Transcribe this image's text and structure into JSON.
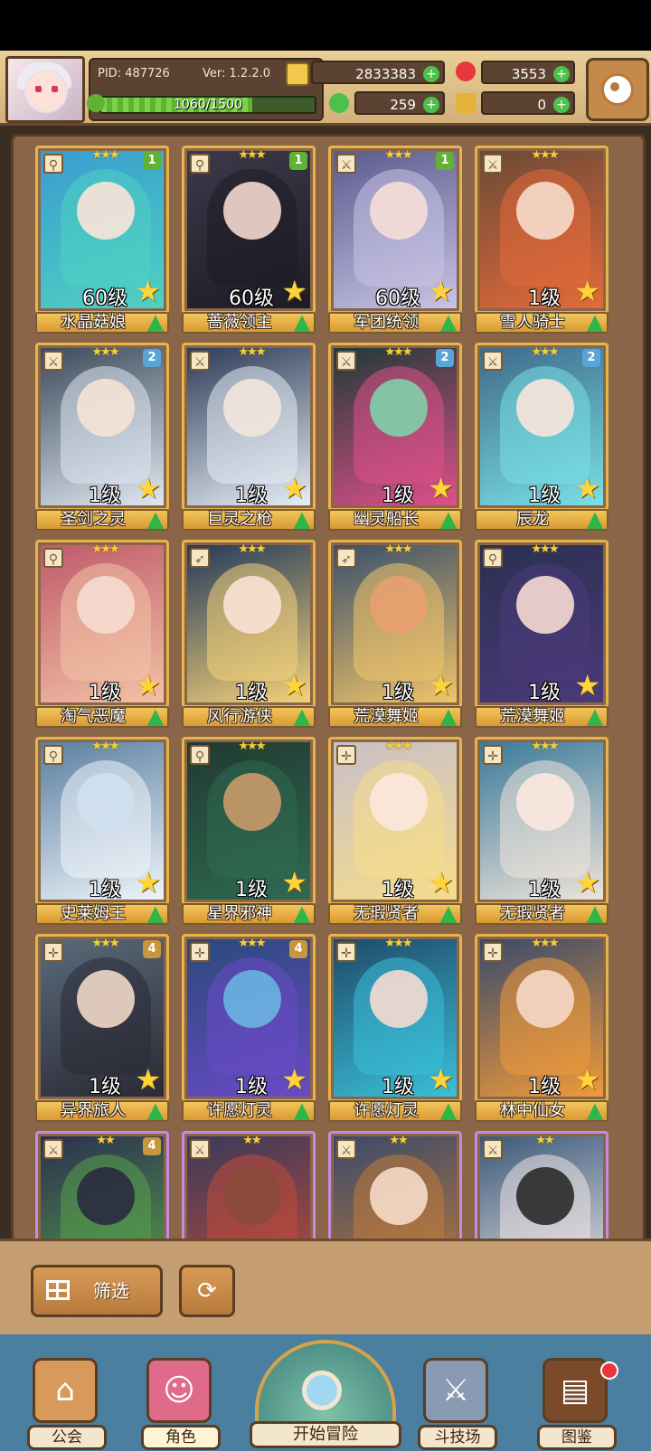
{
  "header": {
    "pid": "PID: 487726",
    "version": "Ver: 1.2.2.0",
    "xp": {
      "text": "1060/1500",
      "current": 1060,
      "max": 1500
    },
    "gold": "2833383",
    "gems": "3553",
    "clover": "259",
    "keys": "0"
  },
  "colors": {
    "gold_frame": "#e6b44a",
    "purple_frame": "#c58be2",
    "badge_green": "#5fb234",
    "badge_blue": "#5aa5d8",
    "badge_tan": "#c8963c",
    "upgrade_green": "#2fb548"
  },
  "cards": [
    {
      "name": "水晶菇娘",
      "level": "60级",
      "stars": "★★★",
      "badge": "1",
      "badge_color": "#5fb234",
      "class_icon": "staff-icon",
      "palette": [
        "#3a9ccf",
        "#4fd1c3",
        "#fbe4d8"
      ],
      "rarity": "gold"
    },
    {
      "name": "蔷薇领主",
      "level": "60级",
      "stars": "★★★",
      "badge": "1",
      "badge_color": "#5fb234",
      "class_icon": "staff-icon",
      "palette": [
        "#3b3a4a",
        "#1d1b24",
        "#f6d8d0"
      ],
      "rarity": "gold"
    },
    {
      "name": "军团统领",
      "level": "60级",
      "stars": "★★★",
      "badge": "1",
      "badge_color": "#5fb234",
      "class_icon": "sword-icon",
      "palette": [
        "#5a5a8c",
        "#c8c4e6",
        "#f6ded6"
      ],
      "rarity": "gold"
    },
    {
      "name": "雪人骑士",
      "level": "1级",
      "stars": "★★★",
      "badge": "",
      "badge_color": "",
      "class_icon": "sword-icon",
      "palette": [
        "#6b4a36",
        "#e46a3a",
        "#f7dccc"
      ],
      "rarity": "gold"
    },
    {
      "name": "圣剑之灵",
      "level": "1级",
      "stars": "★★★",
      "badge": "2",
      "badge_color": "#5aa5d8",
      "class_icon": "sword-icon",
      "palette": [
        "#3d4a5a",
        "#dfe8f2",
        "#f6e2d6"
      ],
      "rarity": "gold"
    },
    {
      "name": "巨灵之枪",
      "level": "1级",
      "stars": "★★★",
      "badge": "",
      "badge_color": "",
      "class_icon": "sword-icon",
      "palette": [
        "#2d3b56",
        "#e6eef6",
        "#f2e6dc"
      ],
      "rarity": "gold"
    },
    {
      "name": "幽灵船长",
      "level": "1级",
      "stars": "★★★",
      "badge": "2",
      "badge_color": "#5aa5d8",
      "class_icon": "sword-icon",
      "palette": [
        "#1f3a36",
        "#e0508a",
        "#7fd0a8"
      ],
      "rarity": "gold"
    },
    {
      "name": "辰龙",
      "level": "1级",
      "stars": "★★★",
      "badge": "2",
      "badge_color": "#5aa5d8",
      "class_icon": "sword-icon",
      "palette": [
        "#3f6a8a",
        "#79e0e6",
        "#f8e6da"
      ],
      "rarity": "gold"
    },
    {
      "name": "淘气恶魔",
      "level": "1级",
      "stars": "★★★",
      "badge": "",
      "badge_color": "",
      "class_icon": "staff-icon",
      "palette": [
        "#c05a6a",
        "#f2c2a6",
        "#f6dcd2"
      ],
      "rarity": "gold"
    },
    {
      "name": "风行游侠",
      "level": "1级",
      "stars": "★★★",
      "badge": "",
      "badge_color": "",
      "class_icon": "bow-icon",
      "palette": [
        "#243a5a",
        "#f4d27a",
        "#f8e2d6"
      ],
      "rarity": "gold"
    },
    {
      "name": "荒漠舞姬",
      "level": "1级",
      "stars": "★★★",
      "badge": "",
      "badge_color": "",
      "class_icon": "bow-icon",
      "palette": [
        "#3a4f6a",
        "#f0c46a",
        "#e8a070"
      ],
      "rarity": "gold"
    },
    {
      "name": "荒漠舞姬",
      "level": "1级",
      "stars": "★★★",
      "badge": "",
      "badge_color": "",
      "class_icon": "staff-icon",
      "palette": [
        "#2a3050",
        "#4a3a7a",
        "#f6dcd2"
      ],
      "rarity": "gold"
    },
    {
      "name": "史莱姆王",
      "level": "1级",
      "stars": "★★★",
      "badge": "",
      "badge_color": "",
      "class_icon": "staff-icon",
      "palette": [
        "#5a7fa0",
        "#eef4fa",
        "#cfe0ee"
      ],
      "rarity": "gold"
    },
    {
      "name": "星界邪神",
      "level": "1级",
      "stars": "★★★",
      "badge": "",
      "badge_color": "",
      "class_icon": "staff-icon",
      "palette": [
        "#213a30",
        "#2f6a52",
        "#c89a6a"
      ],
      "rarity": "gold"
    },
    {
      "name": "无瑕贤者",
      "level": "1级",
      "stars": "★★★",
      "badge": "",
      "badge_color": "",
      "class_icon": "cross-icon",
      "palette": [
        "#c9c0c8",
        "#f6dc8a",
        "#fbe8de"
      ],
      "rarity": "gold"
    },
    {
      "name": "无瑕贤者",
      "level": "1级",
      "stars": "★★★",
      "badge": "",
      "badge_color": "",
      "class_icon": "cross-icon",
      "palette": [
        "#3a7a9a",
        "#efe4da",
        "#fbe8de"
      ],
      "rarity": "gold"
    },
    {
      "name": "异界旅人",
      "level": "1级",
      "stars": "★★★",
      "badge": "4",
      "badge_color": "#c8963c",
      "class_icon": "cross-icon",
      "palette": [
        "#5a6a7a",
        "#2a2a34",
        "#f0d8c8"
      ],
      "rarity": "gold"
    },
    {
      "name": "许愿灯灵",
      "level": "1级",
      "stars": "★★★",
      "badge": "4",
      "badge_color": "#c8963c",
      "class_icon": "cross-icon",
      "palette": [
        "#2a4a7a",
        "#6a4ac6",
        "#6ab4e0"
      ],
      "rarity": "gold"
    },
    {
      "name": "许愿灯灵",
      "level": "1级",
      "stars": "★★★",
      "badge": "",
      "badge_color": "",
      "class_icon": "cross-icon",
      "palette": [
        "#1f4a6a",
        "#3ac0d8",
        "#f6dcd2"
      ],
      "rarity": "gold"
    },
    {
      "name": "林中仙女",
      "level": "1级",
      "stars": "★★★",
      "badge": "",
      "badge_color": "",
      "class_icon": "cross-icon",
      "palette": [
        "#3a4a6a",
        "#f09a3a",
        "#f6d8c8"
      ],
      "rarity": "gold"
    },
    {
      "name": "",
      "level": "",
      "stars": "★★",
      "badge": "4",
      "badge_color": "#c8963c",
      "class_icon": "sword-icon",
      "palette": [
        "#2a3050",
        "#58a04a",
        "#2a2a40"
      ],
      "rarity": "purple"
    },
    {
      "name": "",
      "level": "",
      "stars": "★★",
      "badge": "",
      "badge_color": "",
      "class_icon": "sword-icon",
      "palette": [
        "#3a3a5a",
        "#c04a3a",
        "#8a4a3a"
      ],
      "rarity": "purple"
    },
    {
      "name": "",
      "level": "",
      "stars": "★★",
      "badge": "",
      "badge_color": "",
      "class_icon": "sword-icon",
      "palette": [
        "#3a4a6a",
        "#c07a3a",
        "#f6dcc8"
      ],
      "rarity": "purple"
    },
    {
      "name": "",
      "level": "",
      "stars": "★★",
      "badge": "",
      "badge_color": "",
      "class_icon": "sword-icon",
      "palette": [
        "#3a5a7a",
        "#efe6e6",
        "#2a2a2a"
      ],
      "rarity": "purple"
    }
  ],
  "toolbar": {
    "filter_label": "筛选",
    "reset_icon": "refresh-icon"
  },
  "nav": [
    {
      "label": "公会",
      "icon": "guild-icon"
    },
    {
      "label": "角色",
      "icon": "character-icon"
    },
    {
      "label": "开始冒险",
      "icon": "magnifier-icon"
    },
    {
      "label": "斗技场",
      "icon": "swords-icon"
    },
    {
      "label": "图鉴",
      "icon": "book-icon"
    }
  ]
}
